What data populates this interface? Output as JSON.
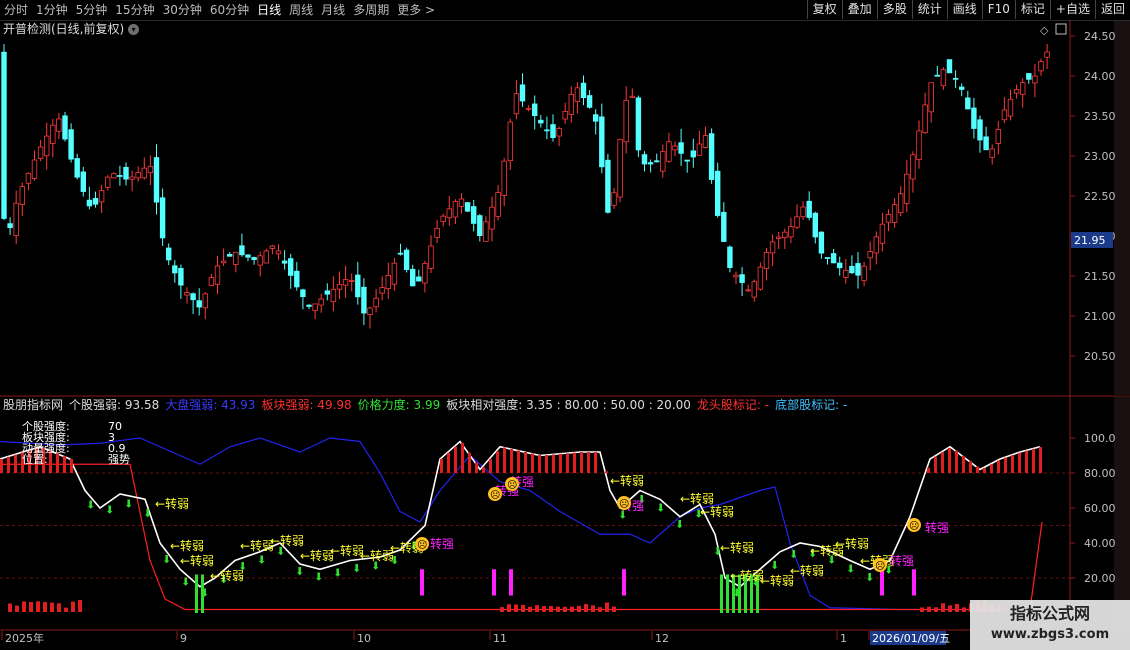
{
  "timeframes": [
    "分时",
    "1分钟",
    "5分钟",
    "15分钟",
    "30分钟",
    "60分钟",
    "日线",
    "周线",
    "月线",
    "多周期",
    "更多 >"
  ],
  "active_timeframe": "日线",
  "toolbar": [
    "复权",
    "叠加",
    "多股",
    "统计",
    "画线",
    "F10",
    "标记",
    "+自选",
    "返回"
  ],
  "main_title": "开普检测(日线,前复权)",
  "main_price_ticks": [
    "24.50",
    "24.00",
    "23.50",
    "23.00",
    "22.50",
    "22.00",
    "21.50",
    "21.00",
    "20.50"
  ],
  "current_price": "21.95",
  "indicator": {
    "name": "股朋指标网",
    "fields": [
      {
        "label": "个股强弱: ",
        "value": "93.58",
        "color": "#dcdcdc"
      },
      {
        "label": "大盘强弱: ",
        "value": "43.93",
        "color": "#3a3aff"
      },
      {
        "label": "板块强弱: ",
        "value": "49.98",
        "color": "#ff3030"
      },
      {
        "label": "价格力度: ",
        "value": "3.99",
        "color": "#30e030"
      },
      {
        "label": "板块相对强度: ",
        "value": "3.35 : 80.00 : 50.00 : 20.00",
        "color": "#dcdcdc"
      },
      {
        "label": "龙头股标记: ",
        "value": "-",
        "color": "#ff3030"
      },
      {
        "label": "底部股标记: ",
        "value": "-",
        "color": "#40c0ff"
      }
    ],
    "overlay_lines": [
      {
        "label": "个股强度:",
        "value": "70"
      },
      {
        "label": "板块强度:",
        "value": "3"
      },
      {
        "label": "动量强度:",
        "value": "0.9"
      },
      {
        "label": "位置:",
        "value": "强势"
      }
    ],
    "y_ticks": [
      "100.0",
      "80.00",
      "60.00",
      "40.00",
      "20.00"
    ],
    "signal_weak": "转弱",
    "signal_strong": "转强"
  },
  "date_axis": [
    "2025年",
    "9",
    "10",
    "11",
    "12",
    "1",
    "2026/01/09/五"
  ],
  "colors": {
    "up": "#ff3a3a",
    "down": "#54ffff",
    "blue": "#2222ee",
    "red": "#ff2020",
    "green": "#30e030",
    "magenta": "#ff22ff",
    "yellow": "#ffff30"
  },
  "watermark": {
    "line1": "指标公式网",
    "line2": "www.zbgs3.com"
  }
}
